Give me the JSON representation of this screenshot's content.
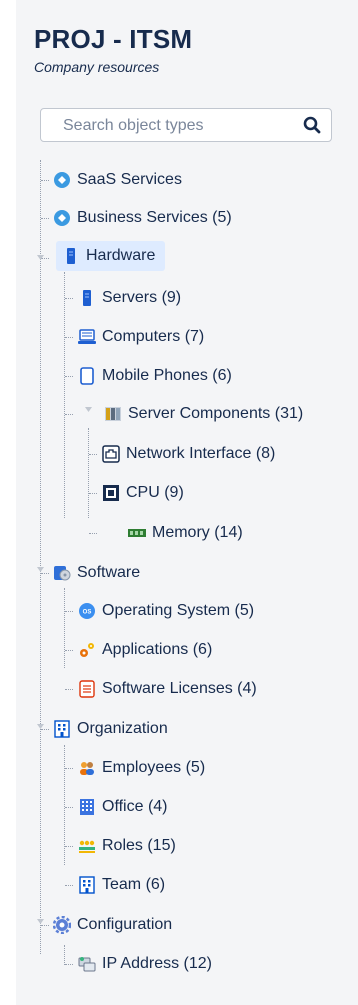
{
  "header": {
    "title": "PROJ - ITSM",
    "subtitle": "Company resources"
  },
  "search": {
    "placeholder": "Search object types",
    "icon": "search-icon"
  },
  "tree": [
    {
      "label": "SaaS Services",
      "icon": "saas-services-icon",
      "color": "#3b9ae1"
    },
    {
      "label": "Business Services (5)",
      "icon": "business-services-icon",
      "color": "#3b9ae1"
    },
    {
      "label": "Hardware",
      "icon": "hardware-icon",
      "color": "#1e5fd1",
      "selected": true
    },
    {
      "label": "Servers (9)",
      "icon": "server-icon"
    },
    {
      "label": "Computers (7)",
      "icon": "computer-icon"
    },
    {
      "label": "Mobile Phones (6)",
      "icon": "mobile-phone-icon"
    },
    {
      "label": "Server Components (31)",
      "icon": "server-components-icon"
    },
    {
      "label": "Network Interface (8)",
      "icon": "network-interface-icon"
    },
    {
      "label": "CPU (9)",
      "icon": "cpu-icon"
    },
    {
      "label": "Memory (14)",
      "icon": "memory-icon"
    },
    {
      "label": "Software",
      "icon": "software-icon"
    },
    {
      "label": "Operating System (5)",
      "icon": "operating-system-icon"
    },
    {
      "label": "Applications (6)",
      "icon": "applications-icon"
    },
    {
      "label": "Software Licenses (4)",
      "icon": "software-licenses-icon"
    },
    {
      "label": "Organization",
      "icon": "organization-icon"
    },
    {
      "label": "Employees (5)",
      "icon": "employees-icon"
    },
    {
      "label": "Office (4)",
      "icon": "office-icon"
    },
    {
      "label": "Roles (15)",
      "icon": "roles-icon"
    },
    {
      "label": "Team (6)",
      "icon": "team-icon"
    },
    {
      "label": "Configuration",
      "icon": "configuration-icon"
    },
    {
      "label": "IP Address (12)",
      "icon": "ip-address-icon"
    }
  ],
  "colors": {
    "selected_bg": "#deebff",
    "text": "#172b4d",
    "panel_bg": "#f4f5f7"
  }
}
